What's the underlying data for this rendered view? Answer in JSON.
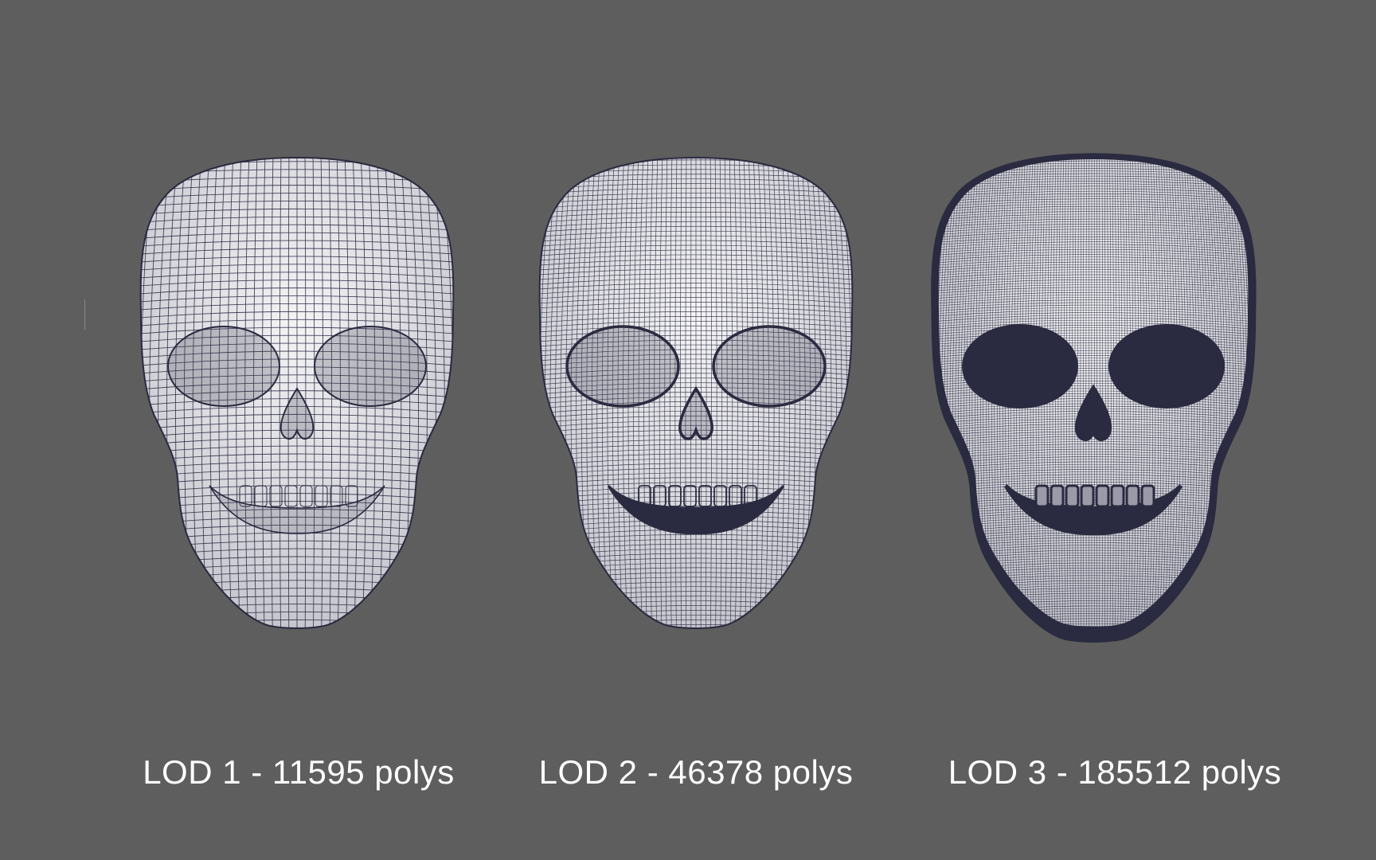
{
  "background_color": "#5e5e5e",
  "mesh_color": "#2a2a40",
  "surface_color": "#e8e8ec",
  "models": [
    {
      "label": "LOD 1 - 11595 polys",
      "mesh_density": 1,
      "icon": "wireframe-skull-icon"
    },
    {
      "label": "LOD 2 - 46378 polys",
      "mesh_density": 2,
      "icon": "wireframe-skull-icon"
    },
    {
      "label": "LOD 3 - 185512 polys",
      "mesh_density": 3,
      "icon": "wireframe-skull-icon"
    }
  ]
}
